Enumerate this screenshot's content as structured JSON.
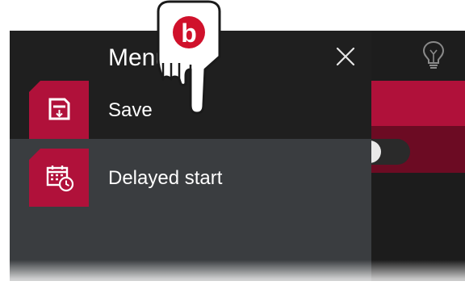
{
  "menu": {
    "title": "Menu",
    "items": [
      {
        "label": "Save",
        "icon": "save-icon"
      },
      {
        "label": "Delayed start",
        "icon": "calendar-clock-icon"
      }
    ]
  },
  "tutorial": {
    "badge": "b",
    "icon": "pointing-hand-icon"
  },
  "icons": {
    "close": "close-icon",
    "hint": "lightbulb-icon"
  },
  "colors": {
    "accent": "#b0113a",
    "accent_dark": "#6c0b23",
    "menu_header_bg": "#1f1f1f",
    "menu_body_bg": "#3a3d40",
    "text": "#ffffff"
  }
}
